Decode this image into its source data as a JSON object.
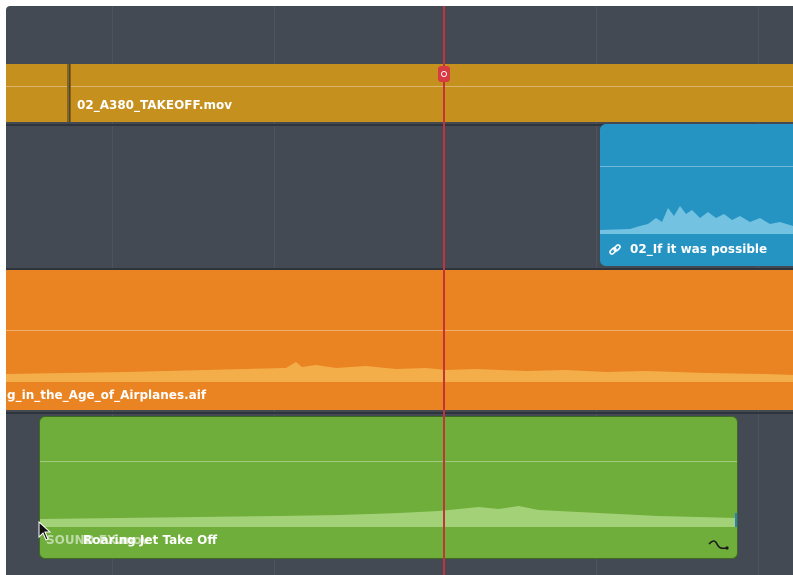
{
  "colors": {
    "background": "#434a54",
    "video_clip": "#c6901f",
    "music_clip": "#2694c2",
    "dialog_clip": "#ea8321",
    "sfx_clip": "#6fae3a",
    "playhead": "#c4323a"
  },
  "tracks": {
    "video": {
      "clip_label": "02_A380_TAKEOFF.mov"
    },
    "music": {
      "clip_label": "02_If it was possible",
      "icon": "link-icon"
    },
    "dialog": {
      "clip_label": "g_in_the_Age_of_Airplanes.aif"
    },
    "sfx": {
      "clip_label": "Roaring Jet Take Off",
      "overlay_label": "SOUND FX.mov",
      "icon": "fade-curve-icon"
    }
  },
  "cursor": {
    "icon": "mouse-pointer-icon"
  }
}
